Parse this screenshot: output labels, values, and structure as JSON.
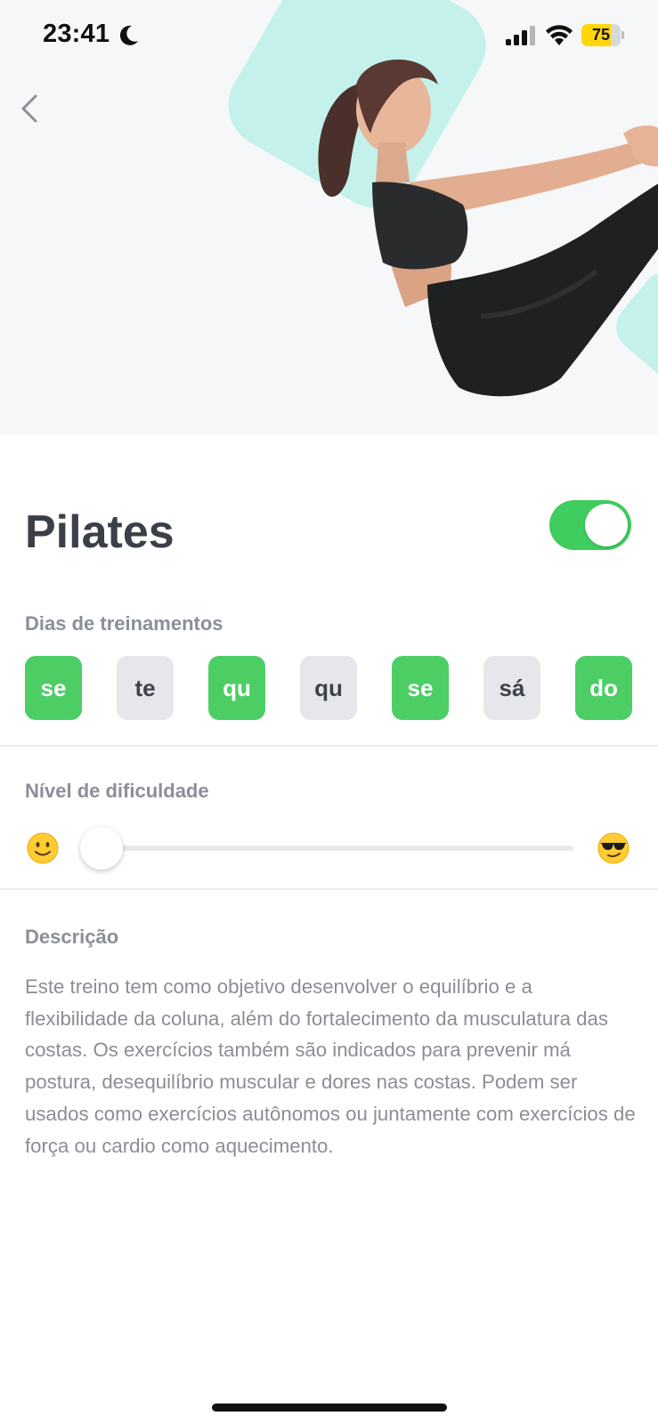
{
  "status_bar": {
    "time": "23:41",
    "battery_level": "75",
    "battery_fraction": 0.75,
    "icons": [
      "moon-icon",
      "signal-icon",
      "wifi-icon",
      "battery-icon"
    ]
  },
  "navigation": {
    "back_icon": "chevron-left-icon"
  },
  "workout": {
    "title": "Pilates",
    "enabled": true
  },
  "training_days": {
    "label": "Dias de treinamentos",
    "days": [
      {
        "label": "se",
        "active": true
      },
      {
        "label": "te",
        "active": false
      },
      {
        "label": "qu",
        "active": true
      },
      {
        "label": "qu",
        "active": false
      },
      {
        "label": "se",
        "active": true
      },
      {
        "label": "sá",
        "active": false
      },
      {
        "label": "do",
        "active": true
      }
    ]
  },
  "difficulty": {
    "label": "Nível de dificuldade",
    "value_fraction": 0.0,
    "min_icon": "smiling-face-emoji-icon",
    "max_icon": "sunglasses-face-emoji-icon"
  },
  "description": {
    "label": "Descrição",
    "text": "Este treino tem como objetivo desenvolver o equilíbrio e a flexibilidade da coluna, além do fortalecimento da musculatura das costas. Os exercícios também são indicados para prevenir má postura, desequilíbrio muscular e dores nas costas. Podem ser usados como exercícios autônomos ou juntamente com exercícios de força ou cardio como aquecimento."
  },
  "colors": {
    "accent_green": "#4cce64",
    "toggle_green": "#3ecd5e",
    "inactive_day": "#e5e7ea",
    "hero_background": "#f6f7f9",
    "hero_shape": "#c4f1ec",
    "battery_yellow": "#ffd60a"
  }
}
